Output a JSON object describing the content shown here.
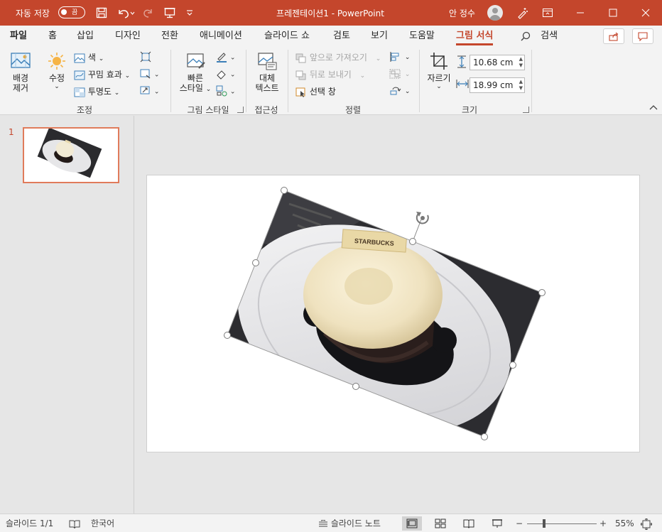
{
  "titlebar": {
    "autosave_label": "자동 저장",
    "autosave_state": "끔",
    "title": "프레젠테이션1  -  PowerPoint",
    "user_name": "안 정수"
  },
  "tabs": [
    {
      "label": "파일"
    },
    {
      "label": "홈"
    },
    {
      "label": "삽입"
    },
    {
      "label": "디자인"
    },
    {
      "label": "전환"
    },
    {
      "label": "애니메이션"
    },
    {
      "label": "슬라이드 쇼"
    },
    {
      "label": "검토"
    },
    {
      "label": "보기"
    },
    {
      "label": "도움말"
    },
    {
      "label": "그림 서식"
    }
  ],
  "search": {
    "label": "검색"
  },
  "ribbon": {
    "adjust": {
      "remove_bg_line1": "배경",
      "remove_bg_line2": "제거",
      "corrections": "수정",
      "color": "색",
      "artistic_effects": "꾸밈 효과",
      "transparency": "투명도",
      "group_label": "조정"
    },
    "styles": {
      "quick_styles_line1": "빠른",
      "quick_styles_line2": "스타일",
      "group_label": "그림 스타일"
    },
    "accessibility": {
      "alt_text_line1": "대체",
      "alt_text_line2": "텍스트",
      "group_label": "접근성"
    },
    "arrange": {
      "bring_forward": "앞으로 가져오기",
      "send_backward": "뒤로 보내기",
      "selection_pane": "선택 창",
      "group_label": "정렬"
    },
    "size": {
      "crop": "자르기",
      "height": "10.68 cm",
      "width": "18.99 cm",
      "group_label": "크기"
    }
  },
  "thumbnails": [
    {
      "number": "1"
    }
  ],
  "slide_image": {
    "label_text": "STARBUCKS"
  },
  "statusbar": {
    "slide_info": "슬라이드 1/1",
    "language": "한국어",
    "notes": "슬라이드 노트",
    "zoom": "55%"
  },
  "colors": {
    "accent": "#c4462c",
    "ribbon_bg": "#f3f3f3",
    "workspace_bg": "#e6e6e6"
  }
}
